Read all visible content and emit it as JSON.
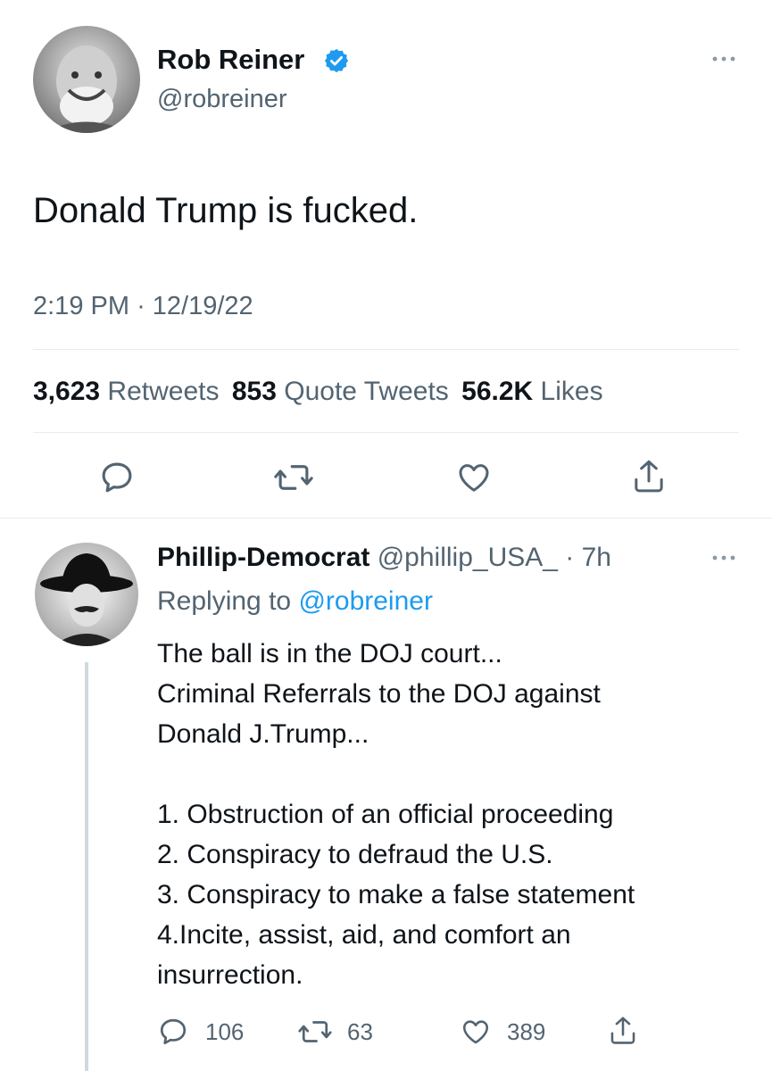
{
  "main_tweet": {
    "author_name": "Rob Reiner",
    "handle": "@robreiner",
    "text": "Donald Trump is fucked.",
    "time": "2:19 PM",
    "date": "12/19/22",
    "date_separator": "·",
    "stats": {
      "retweets_count": "3,623",
      "retweets_label": "Retweets",
      "quotes_count": "853",
      "quotes_label": "Quote Tweets",
      "likes_count": "56.2K",
      "likes_label": "Likes"
    },
    "actions": [
      "reply-icon",
      "retweet-icon",
      "like-icon",
      "share-icon"
    ]
  },
  "reply": {
    "author_name": "Phillip-Democrat",
    "handle": "@phillip_USA_",
    "age": "· 7h",
    "replying_prefix": "Replying to",
    "replying_to": "@robreiner",
    "lines": [
      "The ball is in the DOJ court...",
      "Criminal Referrals to the DOJ against",
      "Donald J.Trump...",
      "",
      "1. Obstruction of an official proceeding",
      "2. Conspiracy to defraud the U.S.",
      "3. Conspiracy to make a false statement",
      "4.Incite, assist, aid, and comfort an",
      "insurrection."
    ],
    "reply_count": "106",
    "retweet_count": "63",
    "like_count": "389"
  },
  "colors": {
    "text": "#0f1419",
    "muted": "#536471",
    "accent": "#1d9bf0",
    "verified": "#1d9bf0",
    "divider": "#e6ecf0"
  }
}
